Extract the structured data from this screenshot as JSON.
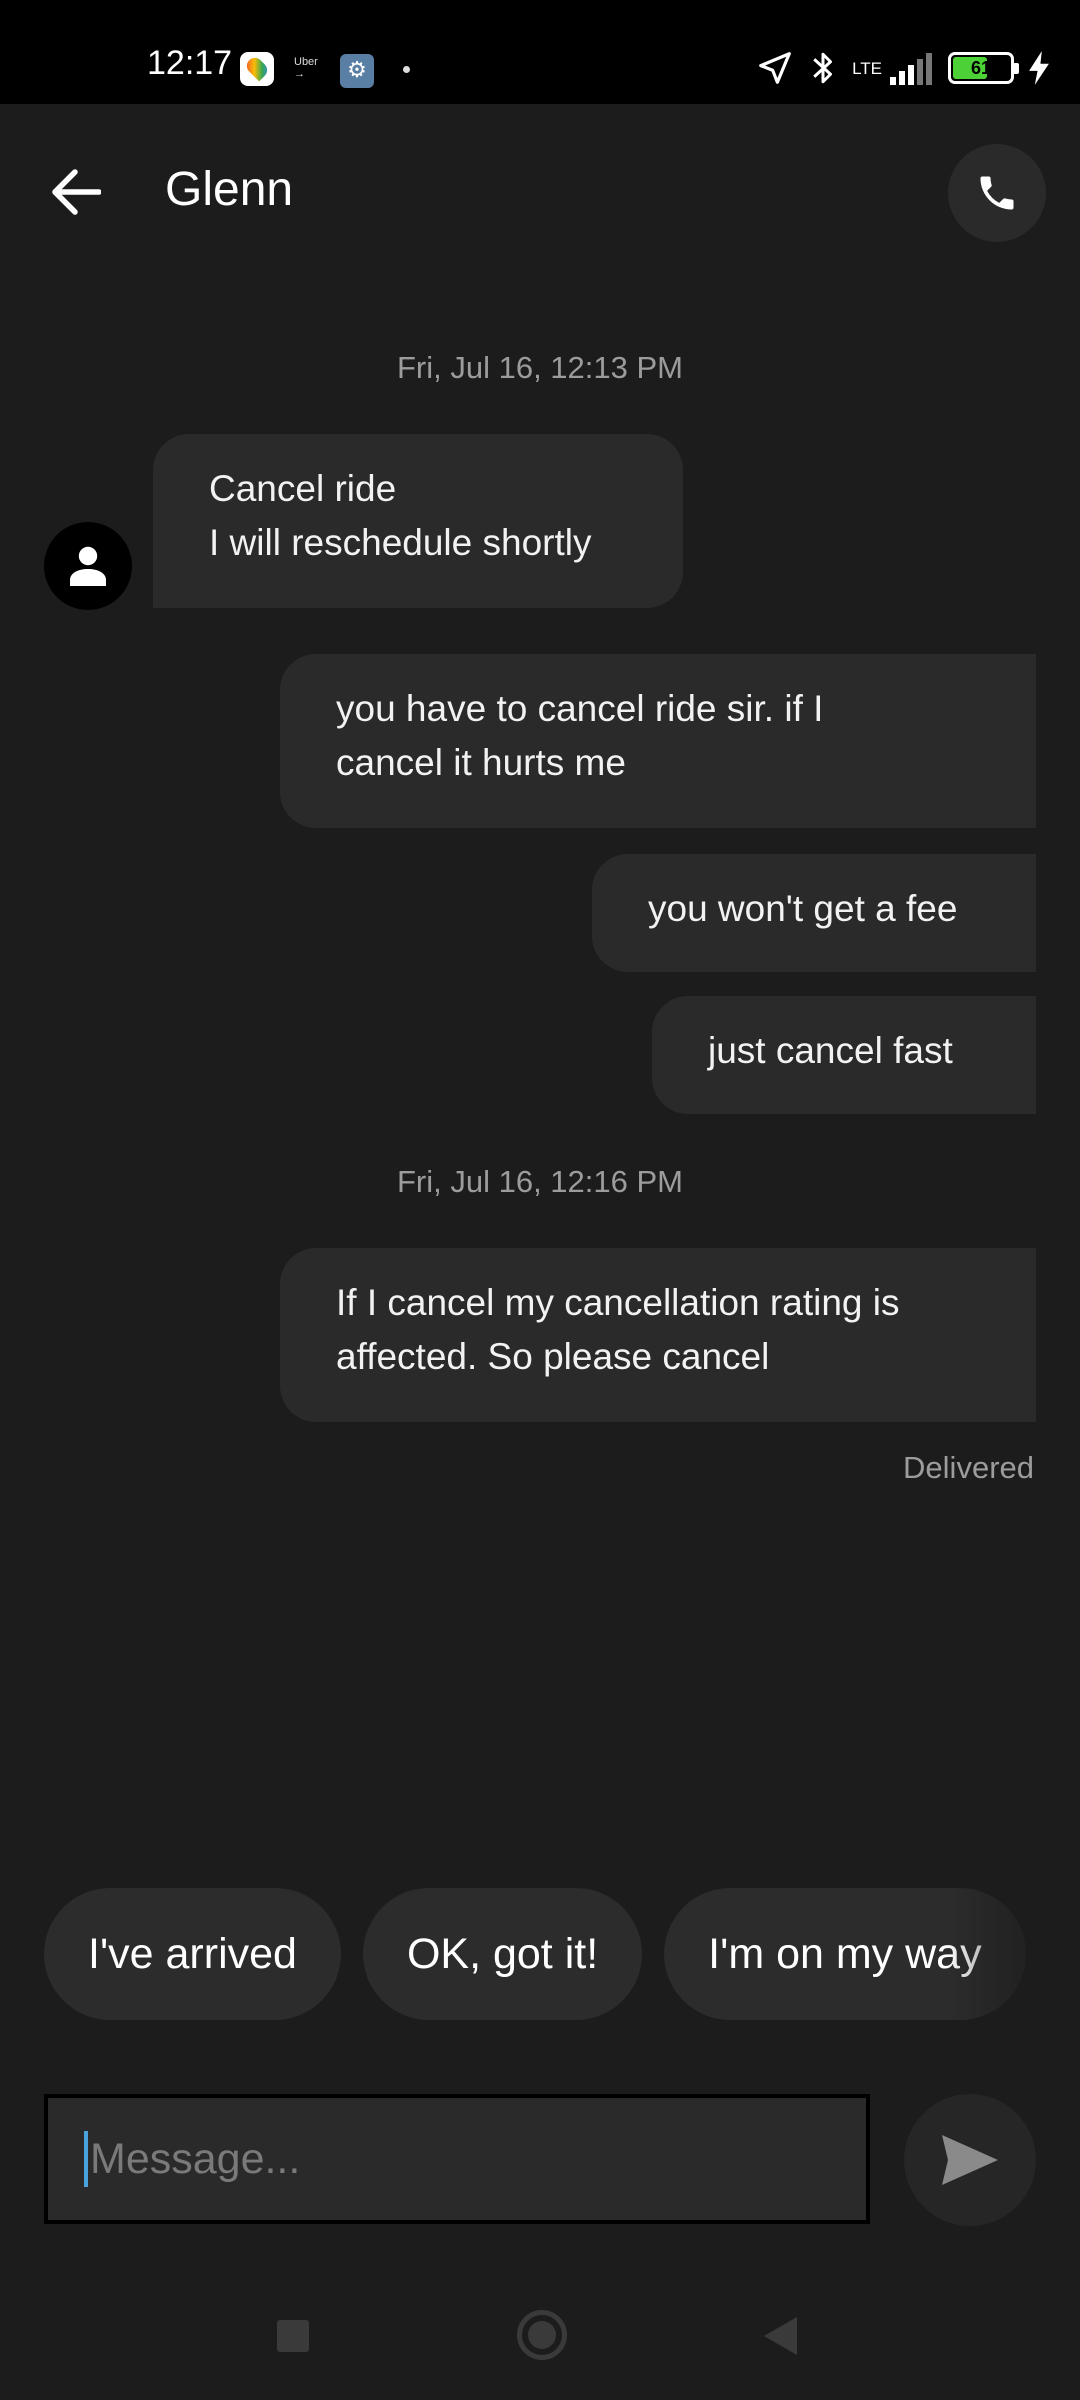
{
  "status_bar": {
    "time": "12:17",
    "uber_label": "Uber",
    "network": "LTE",
    "battery": "61"
  },
  "header": {
    "title": "Glenn"
  },
  "messages": {
    "timestamp_1": "Fri, Jul 16, 12:13 PM",
    "incoming_1": "Cancel ride\nI will reschedule shortly",
    "outgoing_1": "you have to cancel ride sir.  if I\ncancel it hurts me",
    "outgoing_2": "you won't get a fee",
    "outgoing_3": "just cancel fast",
    "timestamp_2": "Fri, Jul 16, 12:16 PM",
    "outgoing_4": "If I cancel my cancellation rating is\naffected.  So please cancel",
    "delivered": "Delivered"
  },
  "quick_replies": [
    "I've arrived",
    "OK, got it!",
    "I'm on my way"
  ],
  "composer": {
    "placeholder": "Message..."
  },
  "icons": {
    "back": "arrow-left-icon",
    "call": "phone-icon",
    "avatar": "person-icon",
    "send": "send-icon"
  },
  "colors": {
    "background": "#1c1c1c",
    "bubble": "#2a2a2a",
    "caret": "#4aa3df",
    "battery": "#4cd137"
  }
}
